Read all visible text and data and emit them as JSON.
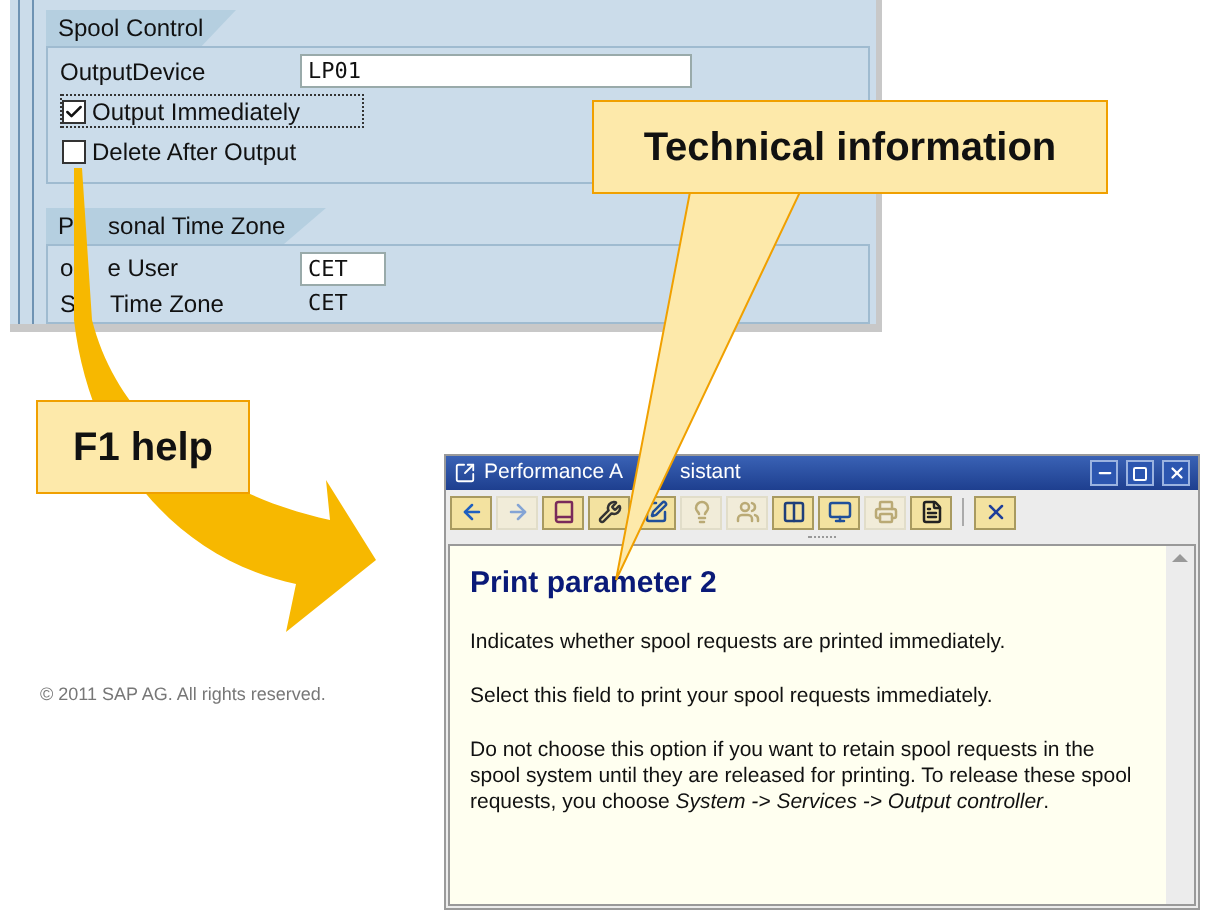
{
  "spool_control": {
    "title": "Spool Control",
    "field": {
      "label": "OutputDevice",
      "value": "LP01"
    },
    "checkboxes": [
      {
        "label": "Output Immediately",
        "checked": true,
        "focused": true
      },
      {
        "label": "Delete After Output",
        "checked": false,
        "focused": false
      }
    ]
  },
  "personal_time_zone": {
    "title_parts": [
      "P",
      "sonal Time Zone"
    ],
    "rows": [
      {
        "kind": "input",
        "label_parts": [
          "o",
          "e User"
        ],
        "value": "CET"
      },
      {
        "kind": "text",
        "label_parts": [
          "S",
          "Time Zone"
        ],
        "value": "CET"
      }
    ]
  },
  "technical_callout": "Technical information",
  "f1_callout": "F1 help",
  "copyright": "© 2011 SAP AG. All rights reserved.",
  "assistant": {
    "title_parts": [
      "Performance A",
      "sistant"
    ],
    "toolbar": [
      {
        "kind": "back",
        "disabled": false
      },
      {
        "kind": "forward",
        "disabled": true
      },
      {
        "kind": "book",
        "disabled": false
      },
      {
        "kind": "technical",
        "disabled": false
      },
      {
        "kind": "edit",
        "disabled": false
      },
      {
        "kind": "hint",
        "disabled": true
      },
      {
        "kind": "users",
        "disabled": true
      },
      {
        "kind": "columns",
        "disabled": false
      },
      {
        "kind": "display",
        "disabled": false
      },
      {
        "kind": "print",
        "disabled": true
      },
      {
        "kind": "page",
        "disabled": false
      },
      {
        "kind": "close",
        "disabled": false
      }
    ],
    "heading": "Print parameter 2",
    "paragraphs": [
      "Indicates whether spool requests are printed immediately.",
      "Select this field to print your spool requests immediately.",
      "Do not choose this option if you want to retain spool requests in the spool system until they are released for printing. To release these spool requests, you choose *System -> Services -> Output controller*."
    ]
  }
}
